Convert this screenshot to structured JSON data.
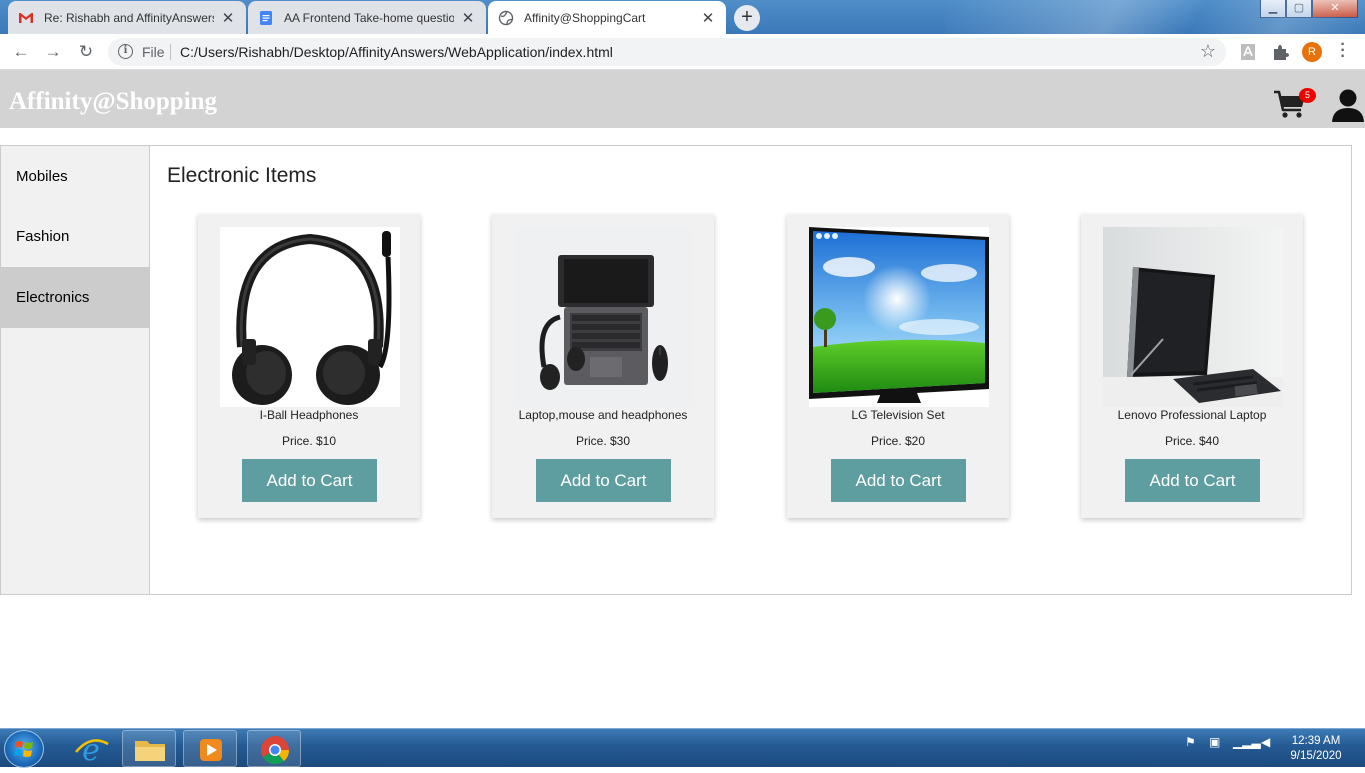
{
  "browser": {
    "tabs": [
      {
        "title": "Re: Rishabh and AffinityAnswers",
        "icon": "gmail-icon",
        "active": false
      },
      {
        "title": "AA Frontend Take-home questio",
        "icon": "docs-icon",
        "active": false
      },
      {
        "title": "Affinity@ShoppingCart",
        "icon": "globe-icon",
        "active": true
      }
    ],
    "address": {
      "scheme_label": "File",
      "url": "C:/Users/Rishabh/Desktop/AffinityAnswers/WebApplication/index.html"
    },
    "profile_initial": "R"
  },
  "header": {
    "brand": "Affinity@Shopping",
    "cart_count": "5"
  },
  "sidebar": {
    "items": [
      {
        "label": "Mobiles"
      },
      {
        "label": "Fashion"
      },
      {
        "label": "Electronics",
        "active": true
      }
    ]
  },
  "main": {
    "title": "Electronic Items",
    "products": [
      {
        "name": "I-Ball Headphones",
        "price": "Price. $10",
        "button": "Add to Cart",
        "image": "headphones"
      },
      {
        "name": "Laptop,mouse and headphones",
        "price": "Price. $30",
        "button": "Add to Cart",
        "image": "laptop-top-view"
      },
      {
        "name": "LG Television Set",
        "price": "Price. $20",
        "button": "Add to Cart",
        "image": "television"
      },
      {
        "name": "Lenovo Professional Laptop",
        "price": "Price. $40",
        "button": "Add to Cart",
        "image": "laptop-stand"
      }
    ]
  },
  "taskbar": {
    "time": "12:39 AM",
    "date": "9/15/2020"
  },
  "colors": {
    "header_bg": "#d3d3d3",
    "button_bg": "#5f9ea0",
    "badge": "#ee0000",
    "sidebar_active": "#cccccc"
  }
}
